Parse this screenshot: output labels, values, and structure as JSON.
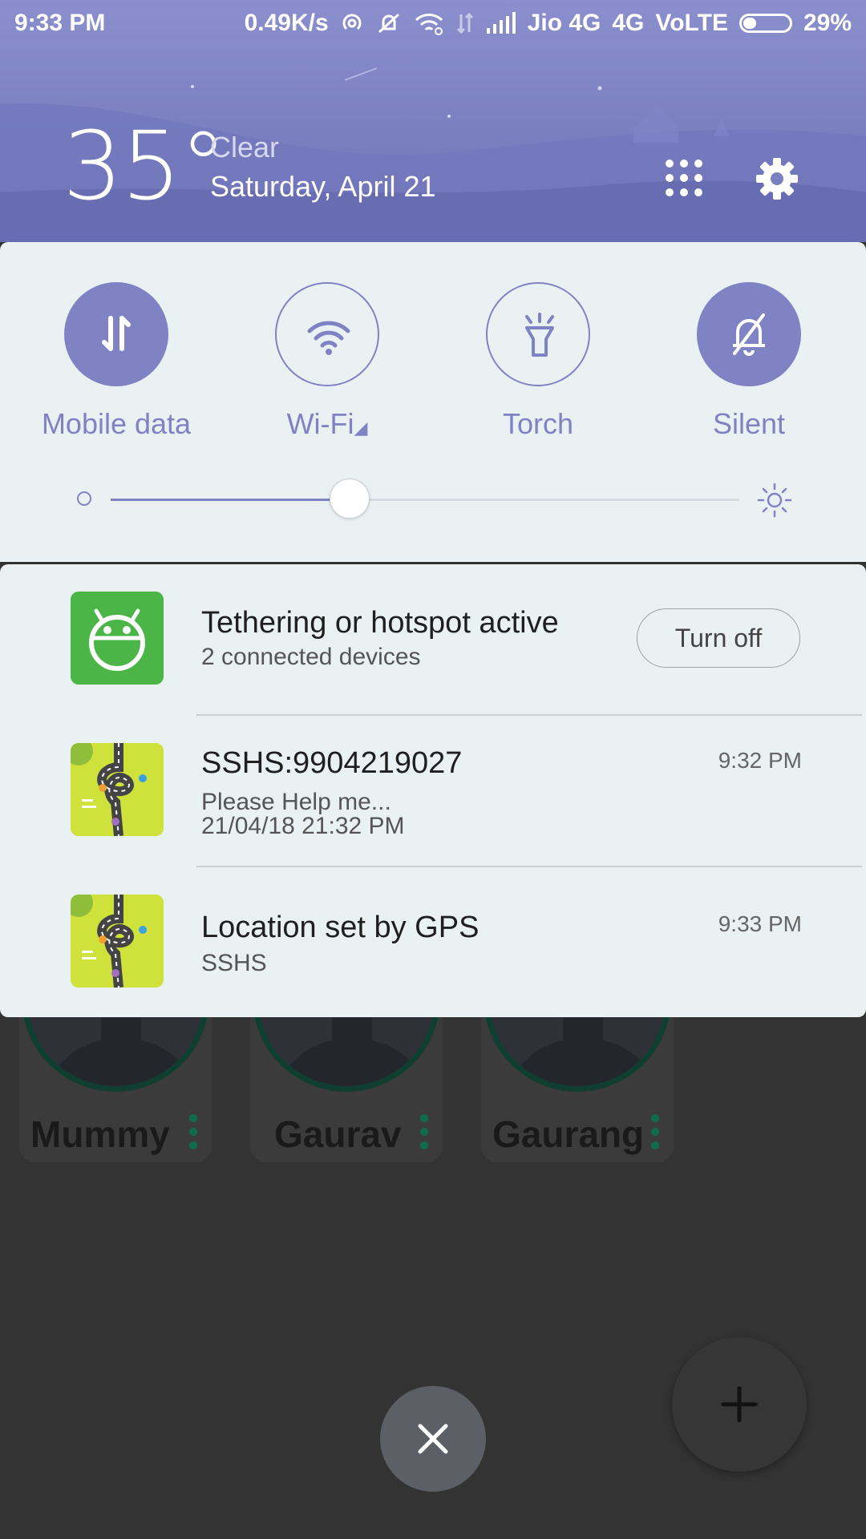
{
  "status_bar": {
    "time": "9:33 PM",
    "speed": "0.49K/s",
    "carrier": "Jio 4G",
    "network": "4G",
    "volte": "VoLTE",
    "battery": "29%"
  },
  "weather": {
    "temperature": "35°",
    "condition": "Clear",
    "date": "Saturday, April 21"
  },
  "quick_settings": {
    "toggles": [
      {
        "label": "Mobile data",
        "icon": "mobile-data-icon",
        "state": "on"
      },
      {
        "label": "Wi-Fi",
        "icon": "wifi-icon",
        "state": "off"
      },
      {
        "label": "Torch",
        "icon": "torch-icon",
        "state": "off"
      },
      {
        "label": "Silent",
        "icon": "silent-icon",
        "state": "on"
      }
    ],
    "brightness": 0.38
  },
  "notifications": [
    {
      "title": "Tethering or hotspot active",
      "subtitle": "2 connected devices",
      "action": "Turn off",
      "icon": "android-icon"
    },
    {
      "title": "SSHS:9904219027",
      "line1": "Please Help me...",
      "line2": "21/04/18 21:32 PM",
      "time": "9:32 PM",
      "icon": "sshs-app-icon"
    },
    {
      "title": "Location set by GPS",
      "subtitle": "SSHS",
      "time": "9:33 PM",
      "icon": "sshs-app-icon"
    }
  ],
  "contacts": [
    {
      "name": "Mummy"
    },
    {
      "name": "Gaurav"
    },
    {
      "name": "Gaurang"
    }
  ],
  "colors": {
    "accent": "#7f83c4",
    "panel": "#eaf1f3",
    "header": "#7a7fc0",
    "app_icon_green": "#4cb548"
  }
}
